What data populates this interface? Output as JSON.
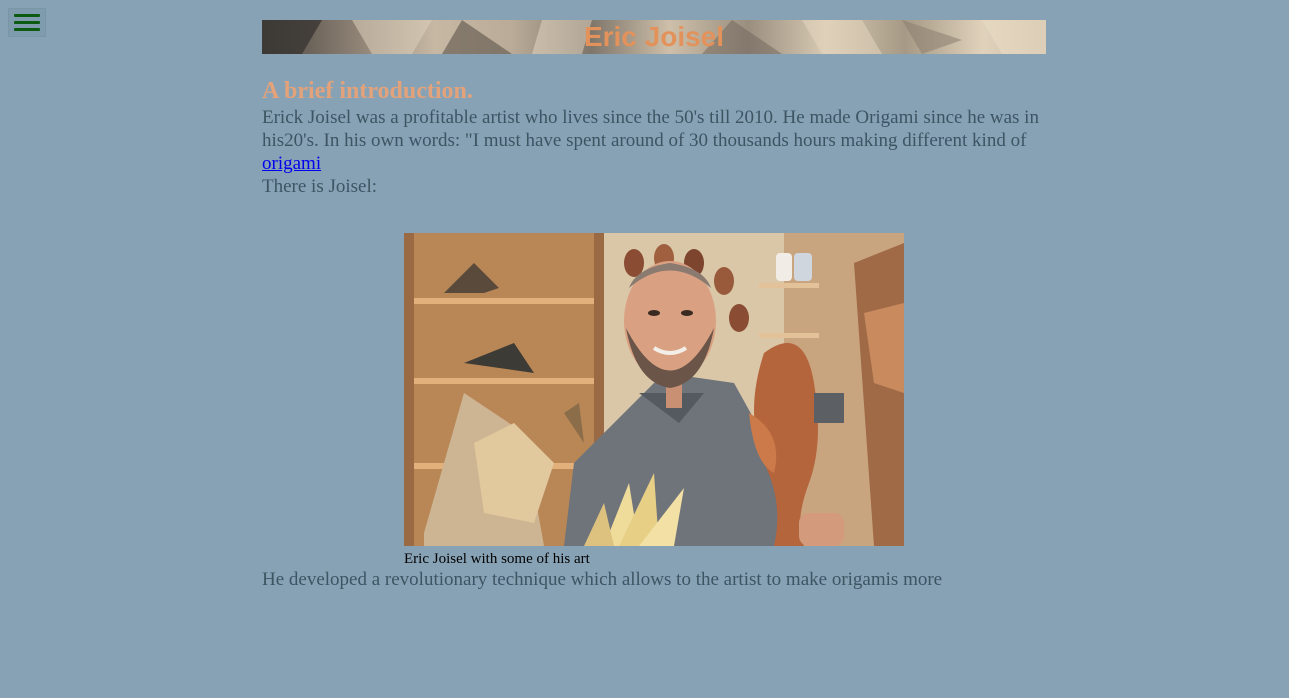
{
  "menu": {
    "icon": "hamburger-menu-icon",
    "icon_color": "#0d5a12"
  },
  "header": {
    "title": "Eric Joisel",
    "title_color": "#e2925a"
  },
  "intro": {
    "heading": "A brief introduction.",
    "paragraph_text": "Erick Joisel was a profitable artist who lives since the 50's till 2010. He made Origami since he was in his20's. In his own words: \"I must have spent around of 30 thousands hours making different kind of ",
    "link_text": "origami"
  },
  "joisel_line": "There is Joisel:",
  "figure": {
    "caption": "Eric Joisel with some of his art"
  },
  "bottom_paragraph": "He developed a revolutionary technique which allows to the artist to make origamis more",
  "colors": {
    "background": "#87a2b5",
    "heading": "#e3a27a",
    "body_text": "#3d5563",
    "link": "#0000ee"
  }
}
